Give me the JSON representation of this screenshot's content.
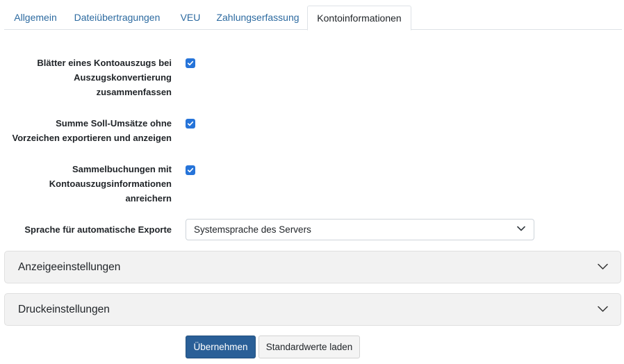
{
  "tabs": [
    {
      "label": "Allgemein",
      "active": false
    },
    {
      "label": "Dateiübertragungen",
      "active": false
    },
    {
      "label": "VEU",
      "active": false
    },
    {
      "label": "Zahlungserfassung",
      "active": false
    },
    {
      "label": "Kontoinformationen",
      "active": true
    }
  ],
  "settings": {
    "merge_pages": {
      "label_lines": [
        "Blätter eines Kontoauszugs bei",
        "Auszugskonvertierung",
        "zusammenfassen"
      ],
      "checked": true
    },
    "debit_sum": {
      "label_lines": [
        "Summe Soll-Umsätze ohne",
        "Vorzeichen exportieren und anzeigen"
      ],
      "checked": true
    },
    "enrich_bookings": {
      "label_lines": [
        "Sammelbuchungen mit",
        "Kontoauszugsinformationen",
        "anreichern"
      ],
      "checked": true
    },
    "export_language": {
      "label": "Sprache für automatische Exporte",
      "value": "Systemsprache des Servers"
    }
  },
  "sections": [
    {
      "title": "Anzeigeeinstellungen",
      "expanded": false
    },
    {
      "title": "Druckeinstellungen",
      "expanded": false
    }
  ],
  "buttons": {
    "apply": "Übernehmen",
    "load_defaults": "Standardwerte laden"
  },
  "colors": {
    "link": "#2c6aa0",
    "checkbox": "#2674d9",
    "primary_button": "#2a5f97",
    "accordion_bg": "#f2f2f2"
  },
  "icons": {
    "checkbox": "check-icon",
    "dropdown": "chevron-down-icon",
    "accordion": "chevron-down-icon"
  }
}
